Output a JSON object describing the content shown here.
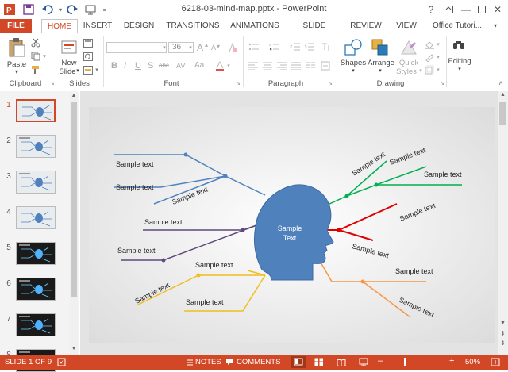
{
  "window": {
    "title": "6218-03-mind-map.pptx - PowerPoint",
    "help": "?",
    "user": "Office Tutori..."
  },
  "tabs": [
    "FILE",
    "HOME",
    "INSERT",
    "DESIGN",
    "TRANSITIONS",
    "ANIMATIONS",
    "SLIDE SHOW",
    "REVIEW",
    "VIEW"
  ],
  "ribbon": {
    "clipboard": {
      "label": "Clipboard",
      "paste": "Paste"
    },
    "slides": {
      "label": "Slides",
      "new_slide_line1": "New",
      "new_slide_line2": "Slide"
    },
    "font": {
      "label": "Font",
      "size": "36",
      "bold": "B",
      "italic": "I",
      "underline": "U",
      "strike": "S",
      "shadow": "abc",
      "spacing": "AV",
      "case": "Aa",
      "grow": "A",
      "shrink": "A"
    },
    "paragraph": {
      "label": "Paragraph"
    },
    "drawing": {
      "label": "Drawing",
      "shapes": "Shapes",
      "arrange": "Arrange",
      "quick_styles_line1": "Quick",
      "quick_styles_line2": "Styles"
    },
    "editing": {
      "label": "Editing"
    }
  },
  "slides": [
    {
      "num": "1",
      "theme": "light",
      "selected": true
    },
    {
      "num": "2",
      "theme": "light",
      "selected": false
    },
    {
      "num": "3",
      "theme": "light",
      "selected": false
    },
    {
      "num": "4",
      "theme": "light",
      "selected": false
    },
    {
      "num": "5",
      "theme": "dark",
      "selected": false
    },
    {
      "num": "6",
      "theme": "dark",
      "selected": false
    },
    {
      "num": "7",
      "theme": "dark",
      "selected": false
    },
    {
      "num": "8",
      "theme": "dark",
      "selected": false
    }
  ],
  "mindmap": {
    "center_label_line1": "Sample",
    "center_label_line2": "Text",
    "head_color": "#4f81bd",
    "branch_colors": {
      "blue": "#4f81bd",
      "purple": "#5f497a",
      "yellow": "#f0be1e",
      "green": "#00b050",
      "red": "#e00000",
      "orange": "#f79646"
    },
    "labels": [
      "Sample text",
      "Sample text",
      "Sample text",
      "Sample text",
      "Sample text",
      "Sample text",
      "Sample text",
      "Sample text",
      "Sample text",
      "Sample text",
      "Sample text",
      "Sample text",
      "Sample text",
      "Sample text",
      "Sample text"
    ]
  },
  "status": {
    "slide_info": "SLIDE 1 OF 9",
    "notes": "NOTES",
    "comments": "COMMENTS",
    "zoom": "50%",
    "zoom_minus": "–",
    "zoom_plus": "+"
  }
}
